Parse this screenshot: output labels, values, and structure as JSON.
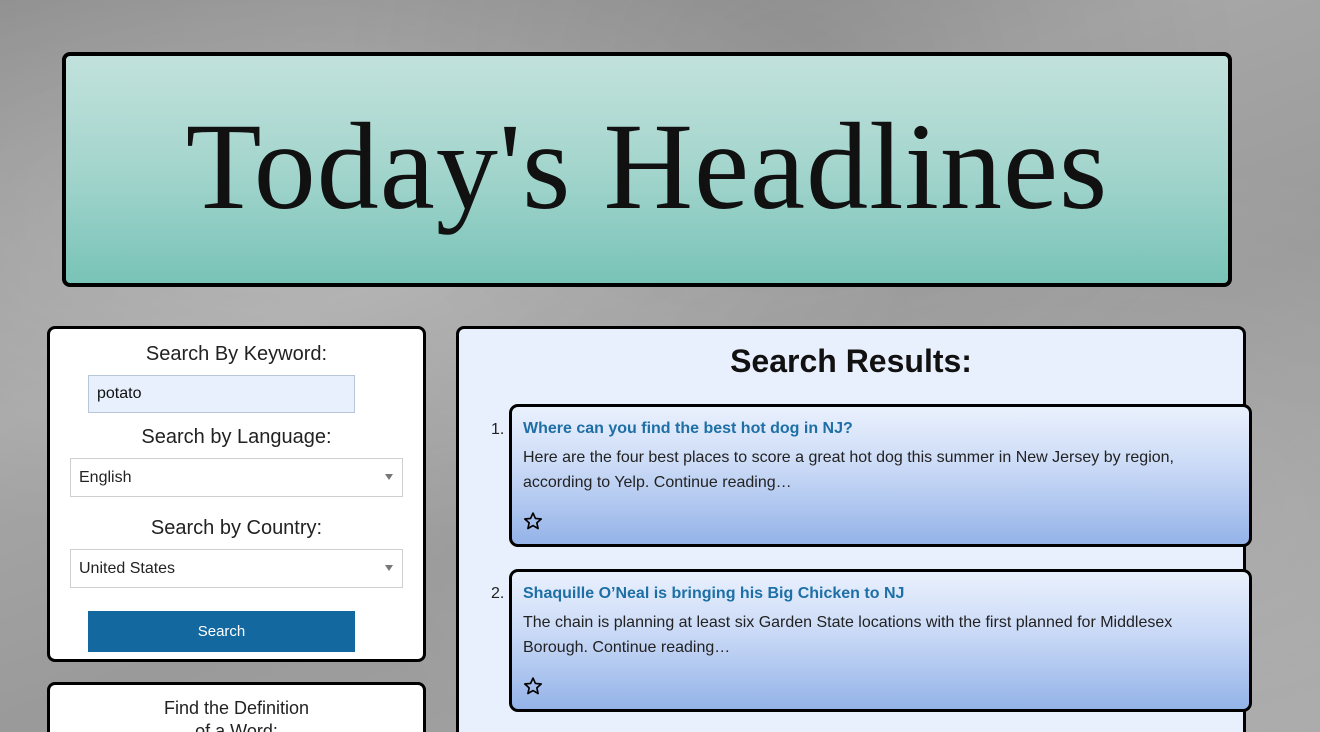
{
  "header": {
    "title": "Today's Headlines"
  },
  "search_panel": {
    "keyword_label": "Search By Keyword:",
    "keyword_value": "potato",
    "language_label": "Search by Language:",
    "language_selected": "English",
    "country_label": "Search by Country:",
    "country_selected": "United States",
    "search_button": "Search"
  },
  "define_panel": {
    "title_line1": "Find the Definition",
    "title_line2": "of a Word:"
  },
  "results": {
    "title": "Search Results:",
    "items": [
      {
        "number": "1.",
        "title": "Where can you find the best hot dog in NJ?",
        "description": "Here are the four best places to score a great hot dog this summer in New Jersey by region, according to Yelp. Continue reading…",
        "favorite_icon": "star-outline-icon"
      },
      {
        "number": "2.",
        "title": "Shaquille O’Neal is bringing his Big Chicken to NJ",
        "description": "The chain is planning at least six Garden State locations with the first planned for Middlesex Borough. Continue reading…",
        "favorite_icon": "star-outline-icon"
      }
    ]
  },
  "colors": {
    "banner_top": "#c2e2dc",
    "banner_bottom": "#79c3b7",
    "button": "#13699f",
    "link": "#1d6fa6",
    "card_bottom": "#94b3e8",
    "results_bg": "#e9f0fd"
  }
}
